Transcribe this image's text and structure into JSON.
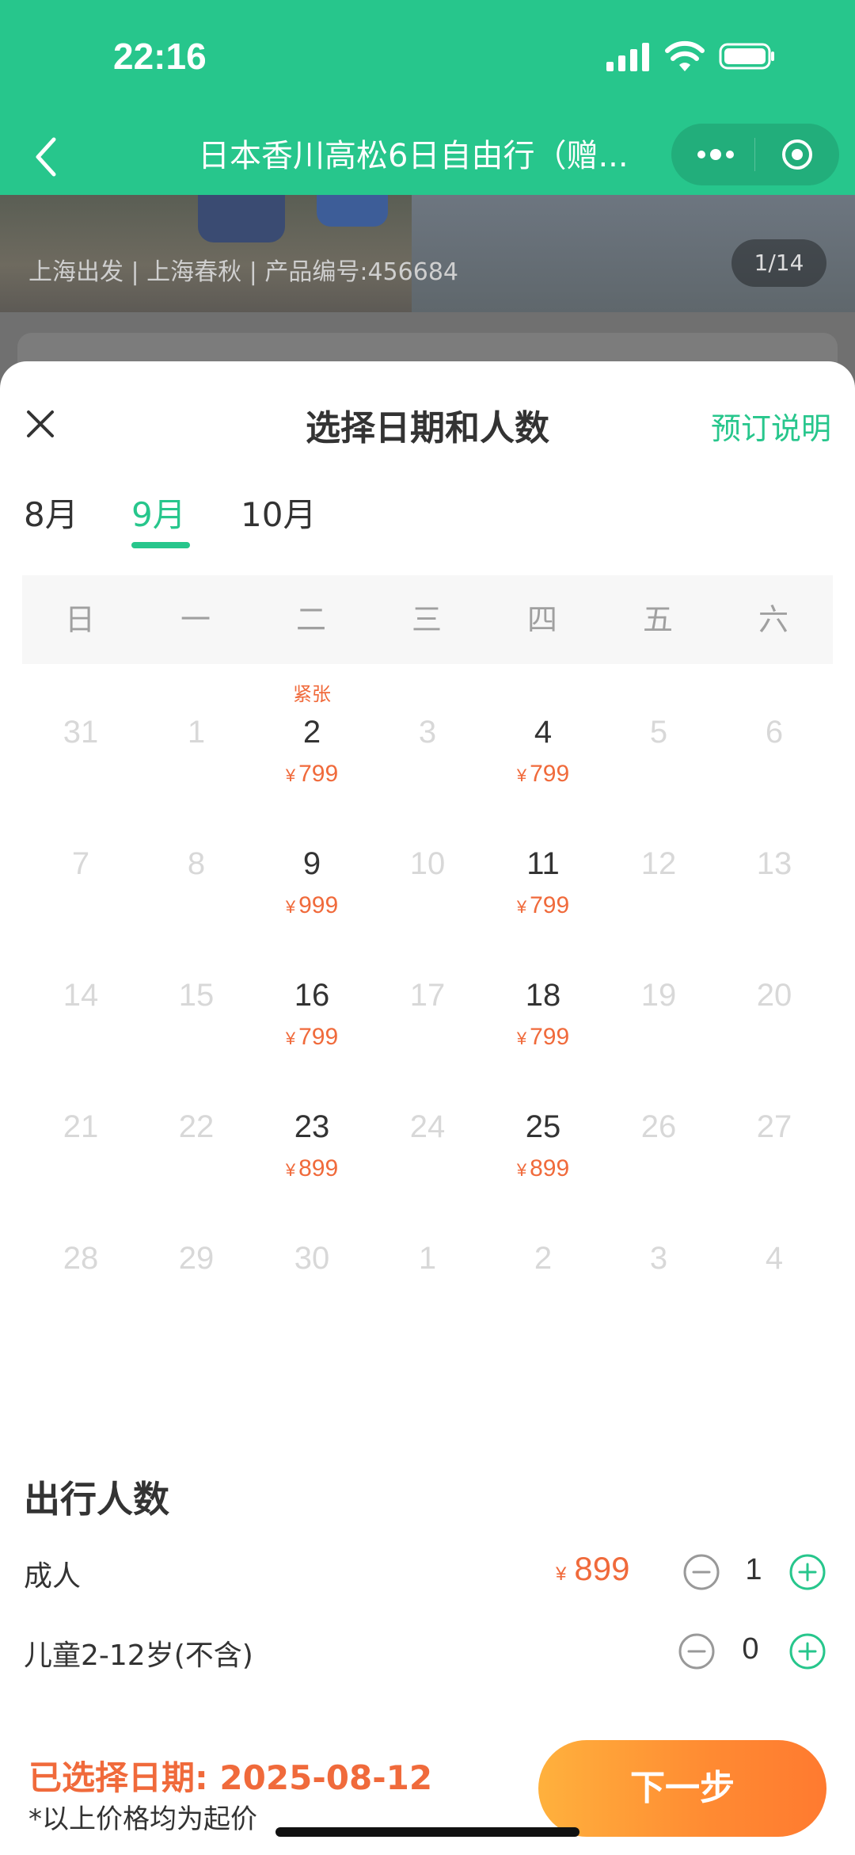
{
  "status_bar": {
    "time": "22:16"
  },
  "nav": {
    "title": "日本香川高松6日自由行（赠..."
  },
  "banner": {
    "info": "上海出发 | 上海春秋 | 产品编号:456684",
    "pager": "1/14"
  },
  "sheet": {
    "title": "选择日期和人数",
    "booking_note": "预订说明",
    "tabs": [
      {
        "label": "8月",
        "active": false
      },
      {
        "label": "9月",
        "active": true
      },
      {
        "label": "10月",
        "active": false
      }
    ],
    "weekdays": [
      "日",
      "一",
      "二",
      "三",
      "四",
      "五",
      "六"
    ],
    "calendar": [
      [
        {
          "day": "31"
        },
        {
          "day": "1"
        },
        {
          "day": "2",
          "price": "799",
          "tag": "紧张"
        },
        {
          "day": "3"
        },
        {
          "day": "4",
          "price": "799"
        },
        {
          "day": "5"
        },
        {
          "day": "6"
        }
      ],
      [
        {
          "day": "7"
        },
        {
          "day": "8"
        },
        {
          "day": "9",
          "price": "999"
        },
        {
          "day": "10"
        },
        {
          "day": "11",
          "price": "799"
        },
        {
          "day": "12"
        },
        {
          "day": "13"
        }
      ],
      [
        {
          "day": "14"
        },
        {
          "day": "15"
        },
        {
          "day": "16",
          "price": "799"
        },
        {
          "day": "17"
        },
        {
          "day": "18",
          "price": "799"
        },
        {
          "day": "19"
        },
        {
          "day": "20"
        }
      ],
      [
        {
          "day": "21"
        },
        {
          "day": "22"
        },
        {
          "day": "23",
          "price": "899"
        },
        {
          "day": "24"
        },
        {
          "day": "25",
          "price": "899"
        },
        {
          "day": "26"
        },
        {
          "day": "27"
        }
      ],
      [
        {
          "day": "28"
        },
        {
          "day": "29"
        },
        {
          "day": "30"
        },
        {
          "day": "1"
        },
        {
          "day": "2"
        },
        {
          "day": "3"
        },
        {
          "day": "4"
        }
      ]
    ],
    "currency": "¥",
    "travelers": {
      "title": "出行人数",
      "adult": {
        "label": "成人",
        "price": "899",
        "count": "1"
      },
      "child": {
        "label": "儿童2-12岁(不含)",
        "count": "0"
      }
    },
    "footer": {
      "selected_date": "已选择日期: 2025-08-12",
      "note": "*以上价格均为起价",
      "next_button": "下一步"
    }
  },
  "colors": {
    "accent": "#27c68c",
    "price": "#f06a3b",
    "button": "#ff8a32"
  }
}
